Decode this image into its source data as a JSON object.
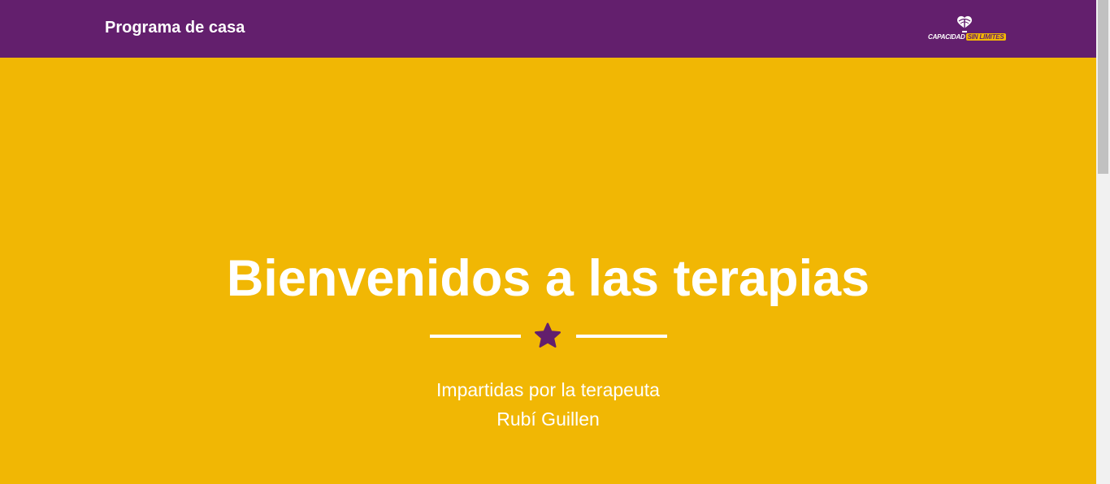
{
  "navbar": {
    "brand": "Programa de casa",
    "logo": {
      "word1": "CAPACIDAD",
      "word2": "SIN LIMITES",
      "icon": "palm-tree-logo-icon"
    }
  },
  "hero": {
    "title": "Bienvenidos a las terapias",
    "divider_icon": "star-icon",
    "subtitle_line1": "Impartidas por la terapeuta",
    "subtitle_line2": "Rubí Guillen"
  },
  "colors": {
    "navbar_bg": "#631f6d",
    "hero_bg": "#f1b704",
    "accent": "#631f6d",
    "text": "#ffffff"
  }
}
